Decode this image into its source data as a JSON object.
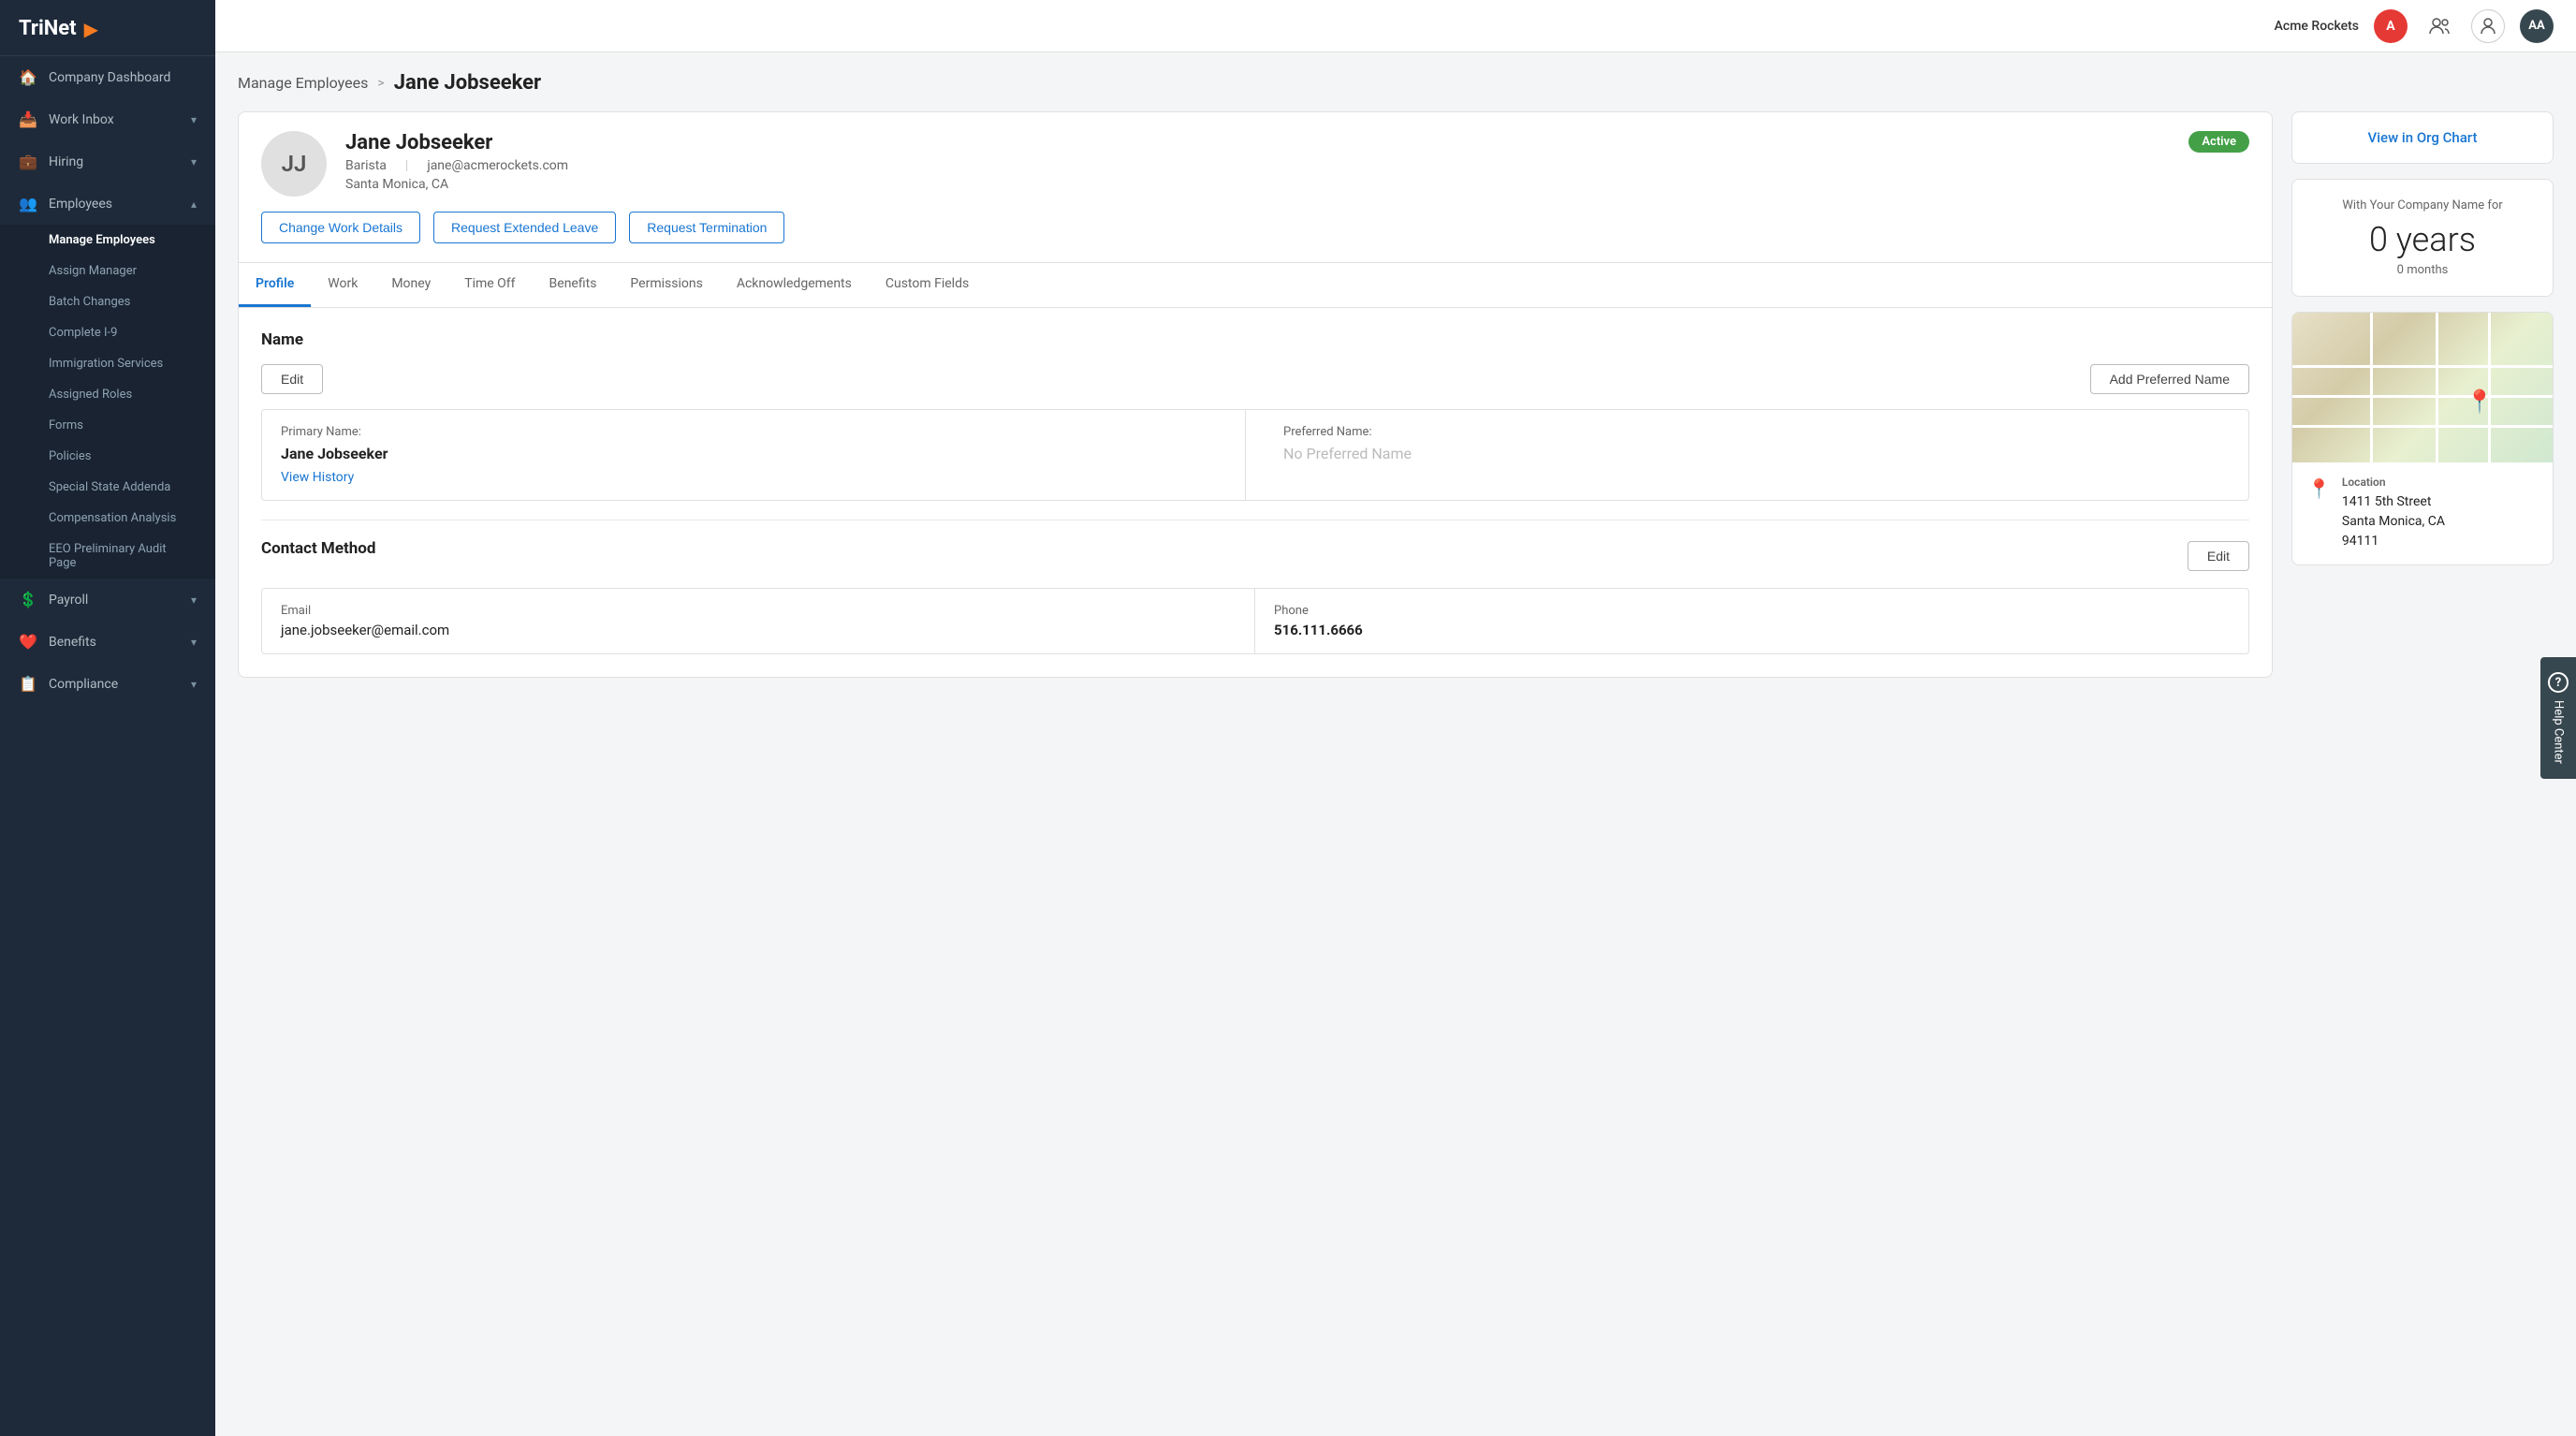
{
  "app": {
    "name": "TriNet",
    "logo_arrow": "▶"
  },
  "topbar": {
    "company_name": "Acme Rockets",
    "company_abbr": "A",
    "team_icon": "👥",
    "user_icon": "👤",
    "avatar_initials": "AA"
  },
  "sidebar": {
    "nav_items": [
      {
        "id": "company-dashboard",
        "label": "Company Dashboard",
        "icon": "🏠",
        "active": false,
        "has_submenu": false
      },
      {
        "id": "work-inbox",
        "label": "Work Inbox",
        "icon": "📥",
        "active": false,
        "has_submenu": true
      },
      {
        "id": "hiring",
        "label": "Hiring",
        "icon": "💼",
        "active": false,
        "has_submenu": true
      },
      {
        "id": "employees",
        "label": "Employees",
        "icon": "👥",
        "active": true,
        "has_submenu": true
      },
      {
        "id": "payroll",
        "label": "Payroll",
        "icon": "💲",
        "active": false,
        "has_submenu": true
      },
      {
        "id": "benefits",
        "label": "Benefits",
        "icon": "❤️",
        "active": false,
        "has_submenu": true
      },
      {
        "id": "compliance",
        "label": "Compliance",
        "icon": "📋",
        "active": false,
        "has_submenu": true
      }
    ],
    "employee_submenu": [
      {
        "id": "manage-employees",
        "label": "Manage Employees",
        "active": true
      },
      {
        "id": "assign-manager",
        "label": "Assign Manager",
        "active": false
      },
      {
        "id": "batch-changes",
        "label": "Batch Changes",
        "active": false
      },
      {
        "id": "complete-i9",
        "label": "Complete I-9",
        "active": false
      },
      {
        "id": "immigration-services",
        "label": "Immigration Services",
        "active": false
      },
      {
        "id": "assigned-roles",
        "label": "Assigned Roles",
        "active": false
      },
      {
        "id": "forms",
        "label": "Forms",
        "active": false
      },
      {
        "id": "policies",
        "label": "Policies",
        "active": false
      },
      {
        "id": "special-state-addenda",
        "label": "Special State Addenda",
        "active": false
      },
      {
        "id": "compensation-analysis",
        "label": "Compensation Analysis",
        "active": false
      },
      {
        "id": "eeo-audit",
        "label": "EEO Preliminary Audit Page",
        "active": false
      }
    ]
  },
  "breadcrumb": {
    "parent": "Manage Employees",
    "separator": ">",
    "current": "Jane Jobseeker"
  },
  "employee": {
    "initials": "JJ",
    "name": "Jane Jobseeker",
    "title": "Barista",
    "email": "jane@acmerockets.com",
    "location": "Santa Monica, CA",
    "status": "Active"
  },
  "action_buttons": {
    "change_work": "Change Work Details",
    "extended_leave": "Request Extended Leave",
    "termination": "Request Termination"
  },
  "tabs": [
    {
      "id": "profile",
      "label": "Profile",
      "active": true
    },
    {
      "id": "work",
      "label": "Work",
      "active": false
    },
    {
      "id": "money",
      "label": "Money",
      "active": false
    },
    {
      "id": "time-off",
      "label": "Time Off",
      "active": false
    },
    {
      "id": "benefits",
      "label": "Benefits",
      "active": false
    },
    {
      "id": "permissions",
      "label": "Permissions",
      "active": false
    },
    {
      "id": "acknowledgements",
      "label": "Acknowledgements",
      "active": false
    },
    {
      "id": "custom-fields",
      "label": "Custom Fields",
      "active": false
    }
  ],
  "profile": {
    "name_section": {
      "title": "Name",
      "edit_btn": "Edit",
      "add_preferred_btn": "Add Preferred Name",
      "primary_label": "Primary Name:",
      "primary_value": "Jane Jobseeker",
      "preferred_label": "Preferred Name:",
      "preferred_empty": "No Preferred Name",
      "view_history": "View History"
    },
    "contact_section": {
      "title": "Contact Method",
      "edit_btn": "Edit",
      "email_label": "Email",
      "email_value": "jane.jobseeker@email.com",
      "phone_label": "Phone",
      "phone_value": "516.111.6666"
    }
  },
  "right_panel": {
    "org_chart_link": "View in Org Chart",
    "tenure_label": "With Your Company Name for",
    "tenure_years": "0 years",
    "tenure_months": "0 months",
    "location_label": "Location",
    "location_address": "1411 5th Street\nSanta Monica, CA\n94111"
  },
  "help_center": {
    "label": "Help Center",
    "icon": "?"
  }
}
